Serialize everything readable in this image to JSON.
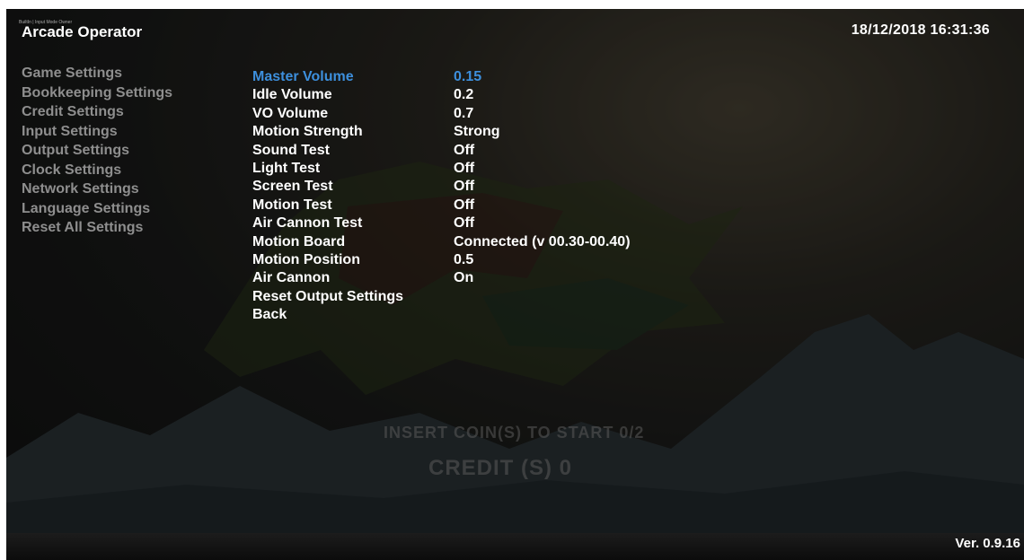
{
  "header": {
    "title": "Arcade Operator",
    "caption": "BuiltIn | Input Mode Owner",
    "datetime": "18/12/2018  16:31:36"
  },
  "footer": {
    "version": "Ver. 0.9.16"
  },
  "attract": {
    "insert_text": "INSERT COIN(S) TO START 0/2",
    "credit_text": "CREDIT (S)  0"
  },
  "categories": [
    "Game Settings",
    "Bookkeeping Settings",
    "Credit Settings",
    "Input Settings",
    "Output Settings",
    "Clock Settings",
    "Network Settings",
    "Language Settings",
    "Reset All Settings"
  ],
  "settings": [
    {
      "label": "Master Volume",
      "value": "0.15"
    },
    {
      "label": "Idle Volume",
      "value": "0.2"
    },
    {
      "label": "VO Volume",
      "value": "0.7"
    },
    {
      "label": "Motion Strength",
      "value": "Strong"
    },
    {
      "label": "Sound Test",
      "value": "Off"
    },
    {
      "label": "Light Test",
      "value": "Off"
    },
    {
      "label": "Screen Test",
      "value": "Off"
    },
    {
      "label": "Motion Test",
      "value": "Off"
    },
    {
      "label": "Air Cannon Test",
      "value": "Off"
    },
    {
      "label": "Motion Board",
      "value": "Connected (v 00.30-00.40)"
    },
    {
      "label": "Motion Position",
      "value": "0.5"
    },
    {
      "label": "Air Cannon",
      "value": "On"
    },
    {
      "label": "Reset Output Settings",
      "value": ""
    },
    {
      "label": "Back",
      "value": ""
    }
  ],
  "selected_setting": "Master Volume",
  "colors": {
    "selected": "#3d8fdc",
    "category": "#8e8e8e",
    "text": "#ffffff"
  }
}
